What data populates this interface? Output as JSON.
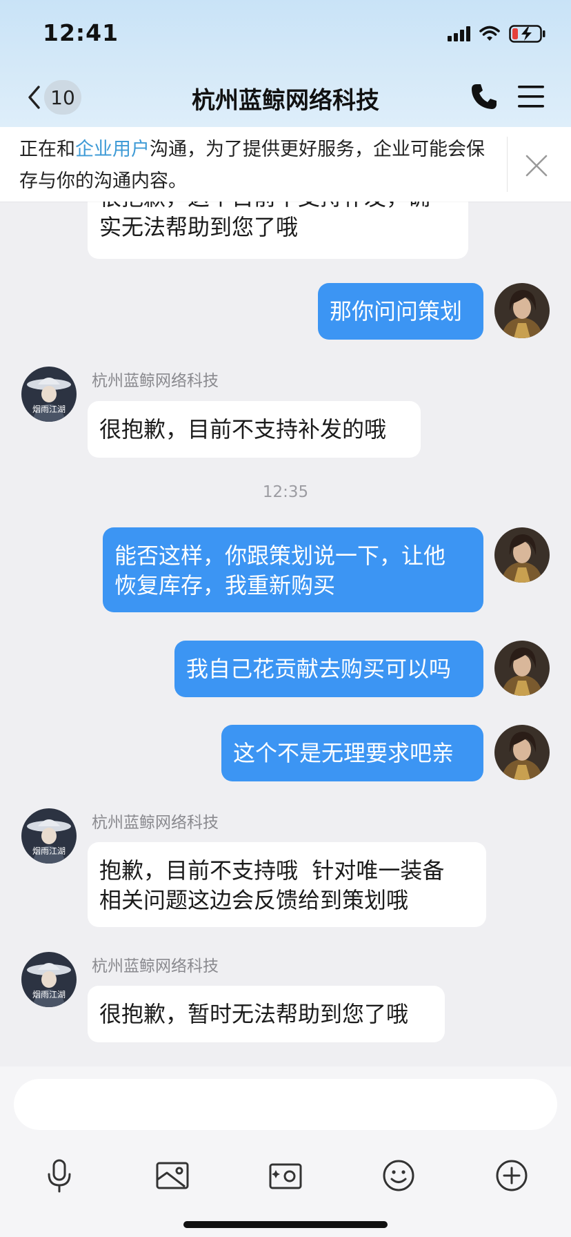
{
  "status_bar": {
    "time": "12:41",
    "icons": [
      "cellular-signal-icon",
      "wifi-icon",
      "battery-low-charging-icon"
    ]
  },
  "header": {
    "back_icon": "chevron-left-icon",
    "unread_count": "10",
    "title": "杭州蓝鲸网络科技",
    "actions": [
      "phone-icon",
      "menu-icon"
    ]
  },
  "notice": {
    "prefix": "正在和",
    "link": "企业用户",
    "suffix": "沟通，为了提供更好服务，企业可能会保存与你的沟通内容。",
    "close_icon": "close-icon"
  },
  "messages": [
    {
      "direction": "in",
      "partial": true,
      "line1": "很抱歉，这个目前不支持补发，确",
      "line2": "实无法帮助到您了哦"
    },
    {
      "direction": "out",
      "text": "那你问问策划"
    },
    {
      "direction": "in",
      "sender": "杭州蓝鲸网络科技",
      "text": "很抱歉，目前不支持补发的哦"
    },
    {
      "type": "timestamp",
      "text": "12:35"
    },
    {
      "direction": "out",
      "line1": "能否这样，你跟策划说一下，让他",
      "line2": "恢复库存，我重新购买"
    },
    {
      "direction": "out",
      "text": "我自己花贡献去购买可以吗"
    },
    {
      "direction": "out",
      "text": "这个不是无理要求吧亲"
    },
    {
      "direction": "in",
      "sender": "杭州蓝鲸网络科技",
      "line1": "抱歉，目前不支持哦  针对唯一装备",
      "line2": "相关问题这边会反馈给到策划哦"
    },
    {
      "direction": "in",
      "sender": "杭州蓝鲸网络科技",
      "text": "很抱歉，暂时无法帮助到您了哦"
    }
  ],
  "input": {
    "value": "",
    "placeholder": ""
  },
  "toolbar": [
    "microphone-icon",
    "image-icon",
    "camera-icon",
    "emoji-icon",
    "plus-circle-icon"
  ],
  "colors": {
    "header_gradient_top": "#c9e3f7",
    "outgoing_bubble": "#3c95f3",
    "incoming_bubble": "#ffffff",
    "chat_background": "#efeff2",
    "link": "#3f9bd6"
  },
  "avatars": {
    "company_avatar_lettering": "烟雨江湖"
  }
}
